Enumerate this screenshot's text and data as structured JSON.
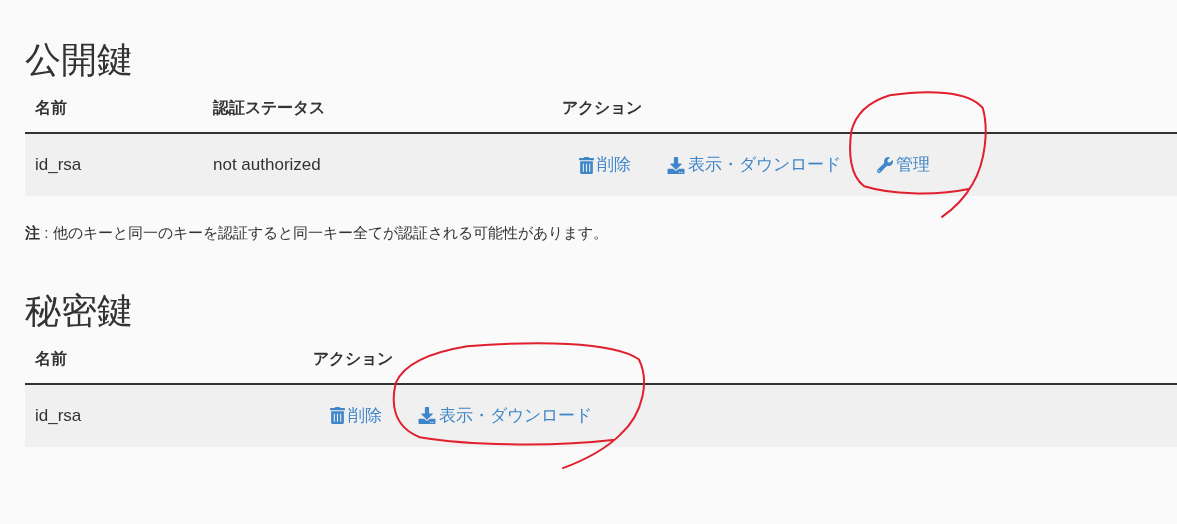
{
  "sections": [
    {
      "title": "公開鍵",
      "columns": [
        "名前",
        "認証ステータス",
        "アクション"
      ],
      "rows": [
        {
          "cells": [
            "id_rsa",
            "not authorized"
          ],
          "actions": [
            {
              "kind": "delete",
              "label": "削除"
            },
            {
              "kind": "download",
              "label": "表示・ダウンロード"
            },
            {
              "kind": "manage",
              "label": "管理",
              "circled": true
            }
          ]
        }
      ],
      "note": "**注** : 他のキーと同一のキーを認証すると同一キー全てが認証される可能性があります。"
    },
    {
      "title": "秘密鍵",
      "columns": [
        "名前",
        "アクション"
      ],
      "rows": [
        {
          "cells": [
            "id_rsa"
          ],
          "actions": [
            {
              "kind": "delete",
              "label": "削除"
            },
            {
              "kind": "download",
              "label": "表示・ダウンロード",
              "circled": true
            }
          ]
        }
      ]
    }
  ]
}
